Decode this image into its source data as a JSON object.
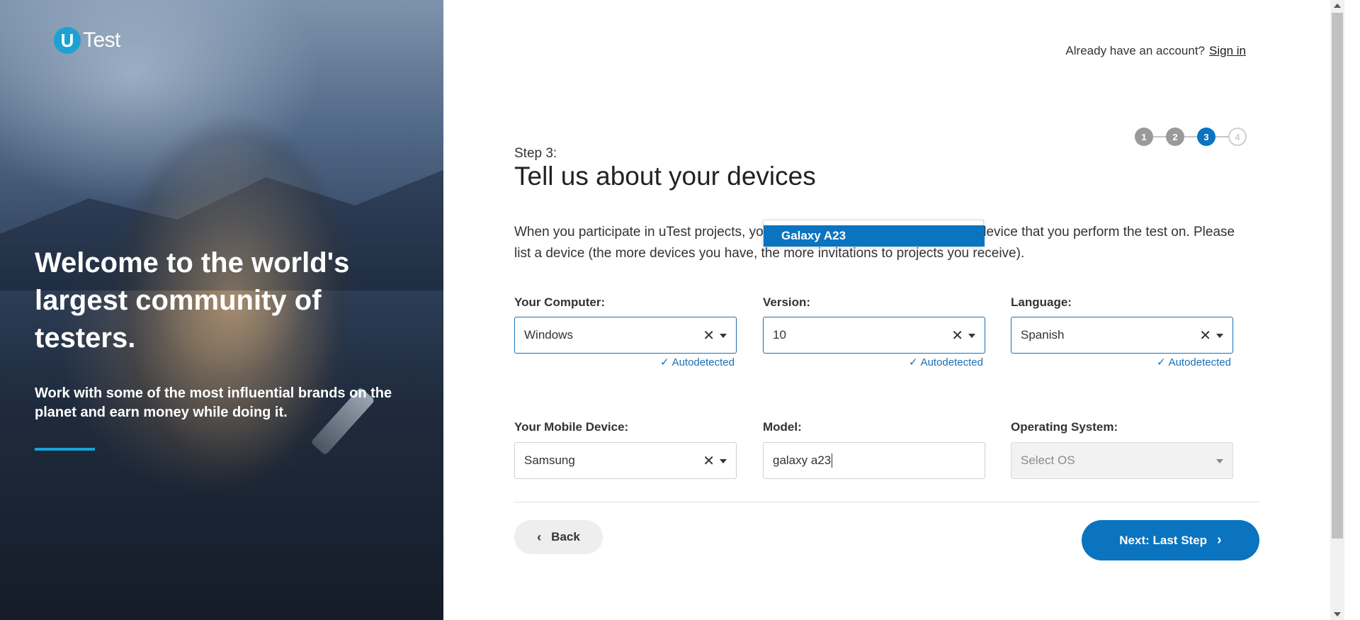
{
  "brand": {
    "mark": "U",
    "word": "Test"
  },
  "hero": {
    "headline": "Welcome to the world's largest community of testers.",
    "subtext": "Work with some of the most influential brands on the planet and earn money while doing it."
  },
  "header": {
    "account_prompt": "Already have an account?",
    "signin_label": "Sign in"
  },
  "steps": [
    {
      "label": "1",
      "state": "done"
    },
    {
      "label": "2",
      "state": "done"
    },
    {
      "label": "3",
      "state": "active"
    },
    {
      "label": "4",
      "state": "todo"
    }
  ],
  "form": {
    "step_label": "Step 3:",
    "title": "Tell us about your devices",
    "intro": "When you participate in uTest projects, you will need to be able to provide the device that you perform the test on. Please list a device (the more devices you have, the more invitations to projects you receive).",
    "computer": {
      "label": "Your Computer:",
      "value": "Windows",
      "autodetected": "Autodetected"
    },
    "version": {
      "label": "Version:",
      "value": "10",
      "autodetected": "Autodetected"
    },
    "language": {
      "label": "Language:",
      "value": "Spanish",
      "autodetected": "Autodetected"
    },
    "mobile": {
      "label": "Your Mobile Device:",
      "value": "Samsung"
    },
    "model": {
      "label": "Model:",
      "value": "galaxy a23",
      "suggestion": "Galaxy A23"
    },
    "os": {
      "label": "Operating System:",
      "placeholder": "Select OS"
    }
  },
  "actions": {
    "back_label": "Back",
    "next_label": "Next: Last Step"
  },
  "colors": {
    "accent": "#0b74c0",
    "brand": "#1ba1d6"
  },
  "icons": {
    "clear": "clear-icon",
    "caret": "caret-down-icon",
    "check": "check-icon",
    "back": "chevron-left-icon",
    "next": "chevron-right-icon"
  }
}
